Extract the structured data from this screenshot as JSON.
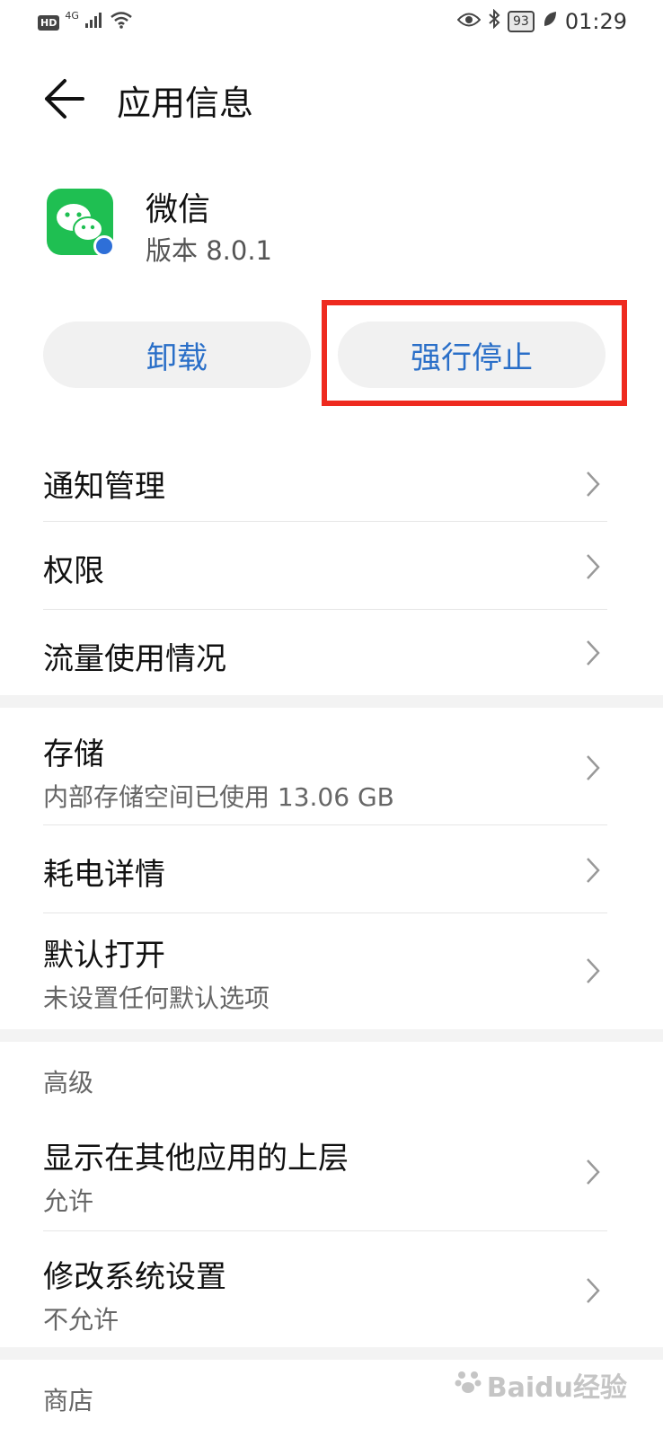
{
  "status_bar": {
    "hd_label": "HD",
    "network_label": "4G",
    "battery_level": "93",
    "time": "01:29"
  },
  "header": {
    "title": "应用信息"
  },
  "app": {
    "name": "微信",
    "version": "版本 8.0.1",
    "icon_color": "#1fbf52",
    "icon": "wechat-icon"
  },
  "buttons": {
    "uninstall": "卸载",
    "force_stop": "强行停止",
    "accent_color": "#2a6fc8",
    "highlight_color": "#ee2a1f"
  },
  "items": {
    "notifications": {
      "title": "通知管理"
    },
    "permissions": {
      "title": "权限"
    },
    "data_usage": {
      "title": "流量使用情况"
    },
    "storage": {
      "title": "存储",
      "subtitle": "内部存储空间已使用 13.06 GB"
    },
    "battery": {
      "title": "耗电详情"
    },
    "default_open": {
      "title": "默认打开",
      "subtitle": "未设置任何默认选项"
    }
  },
  "advanced": {
    "section_label": "高级",
    "display_over": {
      "title": "显示在其他应用的上层",
      "subtitle": "允许"
    },
    "modify_system": {
      "title": "修改系统设置",
      "subtitle": "不允许"
    }
  },
  "store": {
    "section_label": "商店"
  },
  "watermark": {
    "text": "Baidu经验"
  }
}
